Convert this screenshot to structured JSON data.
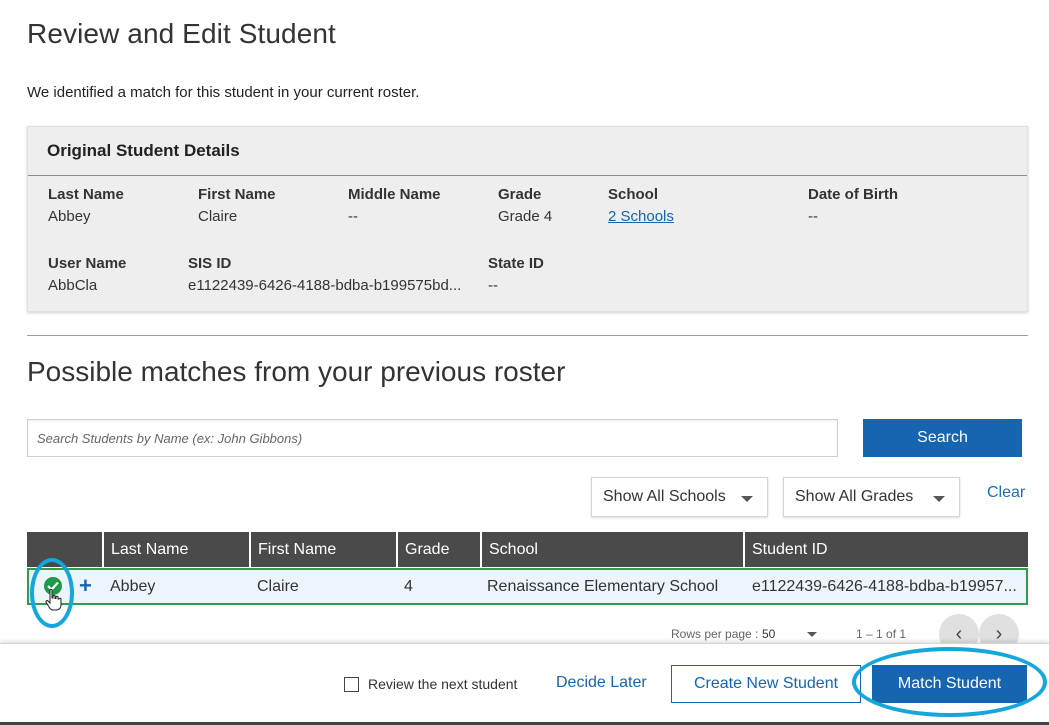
{
  "page": {
    "title": "Review and Edit Student",
    "intro": "We identified a match for this student in your current roster."
  },
  "original": {
    "heading": "Original Student Details",
    "fields": {
      "last_name": {
        "label": "Last Name",
        "value": "Abbey"
      },
      "first_name": {
        "label": "First Name",
        "value": "Claire"
      },
      "middle_name": {
        "label": "Middle Name",
        "value": "--"
      },
      "grade": {
        "label": "Grade",
        "value": "Grade 4"
      },
      "school": {
        "label": "School",
        "value": "2 Schools"
      },
      "dob": {
        "label": "Date of Birth",
        "value": "--"
      },
      "user_name": {
        "label": "User Name",
        "value": "AbbCla"
      },
      "sis_id": {
        "label": "SIS ID",
        "value": "e1122439-6426-4188-bdba-b199575bd..."
      },
      "state_id": {
        "label": "State ID",
        "value": "--"
      }
    }
  },
  "matches": {
    "heading": "Possible matches from your previous roster",
    "search_placeholder": "Search Students by Name (ex: John Gibbons)",
    "search_button": "Search",
    "school_filter": "Show All Schools",
    "grade_filter": "Show All Grades",
    "clear_link": "Clear",
    "columns": [
      "Last Name",
      "First Name",
      "Grade",
      "School",
      "Student ID"
    ],
    "rows": [
      {
        "last_name": "Abbey",
        "first_name": "Claire",
        "grade": "4",
        "school": "Renaissance Elementary School",
        "student_id": "e1122439-6426-4188-bdba-b19957..."
      }
    ],
    "pager": {
      "rows_label": "Rows per page :",
      "rows_value": "50",
      "range": "1 – 1 of 1"
    }
  },
  "footer": {
    "review_next_label": "Review the next student",
    "decide_later": "Decide Later",
    "create_new": "Create New Student",
    "match": "Match Student"
  },
  "icons": {
    "selected": "check-circle-icon",
    "add": "plus-icon",
    "cursor": "hand-pointer-icon",
    "prev": "chevron-left-icon",
    "next": "chevron-right-icon"
  },
  "colors": {
    "primary": "#1565b0",
    "selected_border": "#2e9e4a",
    "highlight_ring": "#13a7dc",
    "table_header": "#4a4a4a"
  }
}
